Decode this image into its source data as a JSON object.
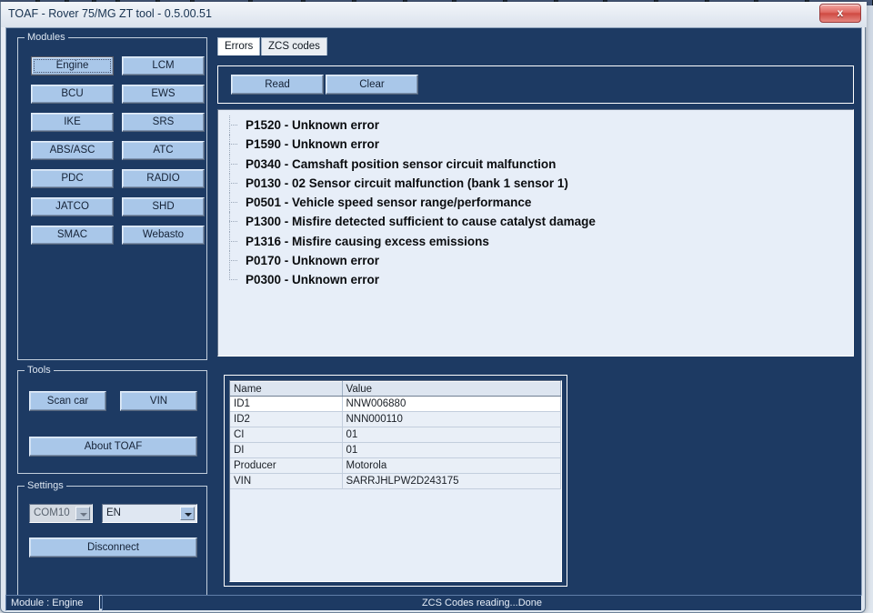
{
  "window": {
    "title": "TOAF - Rover 75/MG ZT tool - 0.5.00.51",
    "close_label": "x",
    "accent_bg": "#1d3a63",
    "button_color": "#a9c7e9"
  },
  "modules": {
    "group_title": "Modules",
    "selected": "Engine",
    "buttons": [
      {
        "label": "Engine"
      },
      {
        "label": "LCM"
      },
      {
        "label": "BCU"
      },
      {
        "label": "EWS"
      },
      {
        "label": "IKE"
      },
      {
        "label": "SRS"
      },
      {
        "label": "ABS/ASC"
      },
      {
        "label": "ATC"
      },
      {
        "label": "PDC"
      },
      {
        "label": "RADIO"
      },
      {
        "label": "JATCO"
      },
      {
        "label": "SHD"
      },
      {
        "label": "SMAC"
      },
      {
        "label": "Webasto"
      }
    ]
  },
  "tools": {
    "group_title": "Tools",
    "scan_car": "Scan car",
    "vin": "VIN",
    "about": "About TOAF"
  },
  "settings": {
    "group_title": "Settings",
    "port_value": "COM10",
    "language_value": "EN",
    "disconnect": "Disconnect"
  },
  "tabs": [
    {
      "label": "Errors",
      "active": true
    },
    {
      "label": "ZCS codes",
      "active": false
    }
  ],
  "toolbar": {
    "read_label": "Read",
    "clear_label": "Clear"
  },
  "errors": [
    "P1520 - Unknown error",
    "P1590 - Unknown error",
    "P0340 - Camshaft position sensor circuit malfunction",
    "P0130 - 02 Sensor circuit malfunction (bank 1 sensor 1)",
    "P0501 - Vehicle speed sensor range/performance",
    "P1300 - Misfire detected sufficient to cause catalyst damage",
    "P1316 - Misfire causing excess emissions",
    "P0170 - Unknown error",
    "P0300 - Unknown error"
  ],
  "zcs_table": {
    "columns": [
      "Name",
      "Value"
    ],
    "rows": [
      [
        "ID1",
        "NNW006880"
      ],
      [
        "ID2",
        "NNN000110"
      ],
      [
        "CI",
        "01"
      ],
      [
        "DI",
        "01"
      ],
      [
        "Producer",
        "Motorola"
      ],
      [
        "VIN",
        "SARRJHLPW2D243175"
      ]
    ]
  },
  "statusbar": {
    "module": "Module : Engine",
    "message": "ZCS Codes reading...Done"
  }
}
